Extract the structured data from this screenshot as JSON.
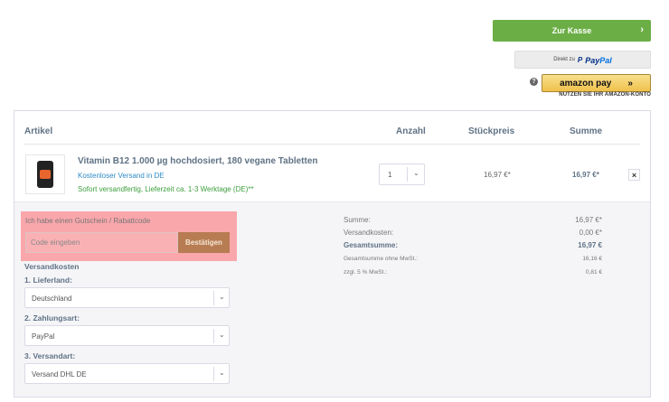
{
  "checkout": {
    "kasse_label": "Zur Kasse",
    "kasse_chevron": "›",
    "paypal_prefix": "Direkt zu",
    "paypal_pay": "Pay",
    "paypal_pal": "Pal",
    "amazon_label": "amazon pay",
    "amazon_arrows": "»",
    "amazon_sub": "NUTZEN SIE IHR AMAZON-KONTO",
    "help_glyph": "?"
  },
  "columns": {
    "artikel": "Artikel",
    "anzahl": "Anzahl",
    "stueckpreis": "Stückpreis",
    "summe": "Summe"
  },
  "item": {
    "name": "Vitamin B12 1.000 µg hochdosiert, 180 vegane Tabletten",
    "shipping_note": "Kostenloser Versand in DE",
    "availability": "Sofort versandfertig, Lieferzeit ca. 1-3 Werktage (DE)**",
    "quantity": "1",
    "unit_price": "16,97 €*",
    "line_total": "16,97 €*",
    "remove_glyph": "×"
  },
  "voucher": {
    "title": "Ich habe einen Gutschein / Rabattcode",
    "placeholder": "Code eingeben",
    "submit_label": "Bestätigen"
  },
  "shipping": {
    "section_label": "Versandkosten",
    "country_label": "1. Lieferland:",
    "country_value": "Deutschland",
    "payment_label": "2. Zahlungsart:",
    "payment_value": "PayPal",
    "method_label": "3. Versandart:",
    "method_value": "Versand DHL DE"
  },
  "summary": {
    "summe_label": "Summe:",
    "summe_value": "16,97 €*",
    "versand_label": "Versandkosten:",
    "versand_value": "0,00 €*",
    "gesamt_label": "Gesamtsumme:",
    "gesamt_value": "16,97 €",
    "netto_label": "Gesamtsumme ohne MwSt.:",
    "netto_value": "16,16 €",
    "mwst_label": "zzgl. 5 % MwSt.:",
    "mwst_value": "0,81 €"
  },
  "icons": {
    "dropdown": "⌄"
  },
  "colors": {
    "kasse_green": "#6cae46",
    "voucher_highlight": "#f9a7ab",
    "voucher_button": "#b77c52",
    "link_blue": "#2f8bc6",
    "available_green": "#3d9e3d"
  }
}
